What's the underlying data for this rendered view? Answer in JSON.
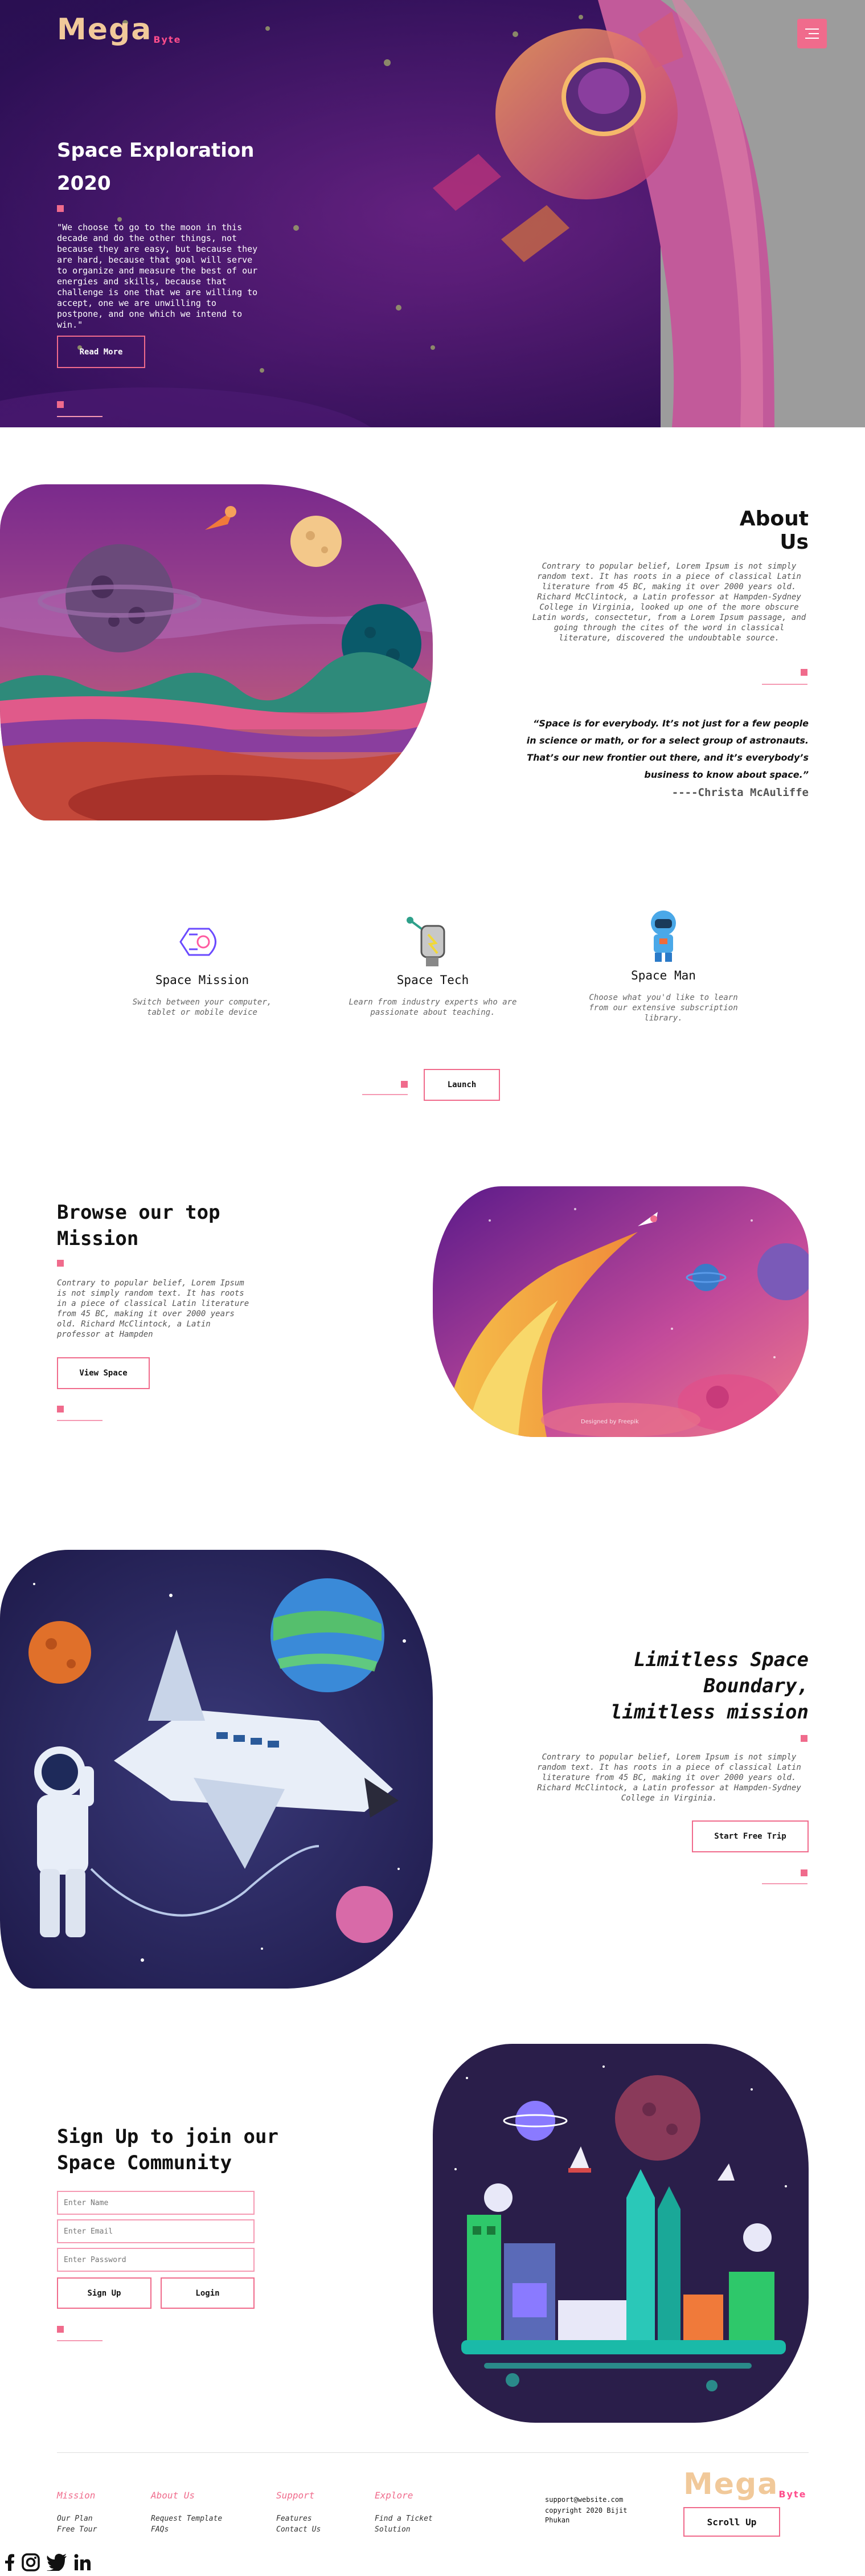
{
  "header": {
    "logo_main": "Mega",
    "logo_sub": "Byte",
    "menu_icon": "menu-icon"
  },
  "hero": {
    "title_line1": "Space Exploration",
    "title_line2": "2020",
    "quote": "\"We choose to go to the moon in this decade and do the other things, not because they are easy, but because they are hard, because that goal will serve to organize and measure the best of our energies and skills, because that challenge is one that we are willing to accept, one we are unwilling to postpone, and one which we intend to win.\"",
    "button": "Read More"
  },
  "about": {
    "title": "About Us",
    "text": "Contrary to popular belief, Lorem Ipsum is not simply random text. It has roots in a piece of classical Latin literature from 45 BC, making it over 2000 years old. Richard McClintock, a Latin professor at Hampden-Sydney College in Virginia, looked up one of the more obscure Latin words, consectetur, from a Lorem Ipsum passage, and going through the cites of the word in classical literature, discovered the undoubtable source.",
    "quote": "“Space is for everybody. It’s not just for a few people in science or math, or for a select group of astronauts. That’s our new frontier out there, and it’s everybody’s business to know about space.”",
    "quote_author": "----Christa McAuliffe"
  },
  "services": {
    "cards": [
      {
        "icon": "rocket-icon",
        "title": "Space Mission",
        "text": "Switch between your computer, tablet or mobile device"
      },
      {
        "icon": "space-tech-icon",
        "title": "Space Tech",
        "text": "Learn from industry experts who are passionate about teaching."
      },
      {
        "icon": "astronaut-icon",
        "title": "Space Man",
        "text": "Choose what you'd like to learn from our extensive subscription library."
      }
    ],
    "button": "Launch"
  },
  "browse": {
    "title_line1": "Browse our top",
    "title_line2": "Mission",
    "text": "Contrary to popular belief, Lorem Ipsum is not simply random text. It has roots in a piece of classical Latin literature from 45 BC, making it over 2000 years old. Richard McClintock, a Latin professor at Hampden",
    "button": "View Space",
    "image_credit": "Designed by Freepik"
  },
  "limitless": {
    "title_line1": "Limitless Space",
    "title_line2": "Boundary,",
    "title_line3": "limitless mission",
    "text": "Contrary to popular belief, Lorem Ipsum is not simply random text. It has roots in a piece of classical Latin literature from 45 BC, making it over 2000 years old. Richard McClintock, a Latin professor at Hampden-Sydney College in Virginia.",
    "button": "Start Free Trip"
  },
  "signup": {
    "title_line1": "Sign Up to join our",
    "title_line2": "Space Community",
    "name_placeholder": "Enter Name",
    "email_placeholder": "Enter Email",
    "password_placeholder": "Enter Password",
    "signup_button": "Sign Up",
    "login_button": "Login"
  },
  "footer": {
    "columns": [
      {
        "heading": "Mission",
        "links": [
          "Our Plan",
          "Free Tour"
        ]
      },
      {
        "heading": "About Us",
        "links": [
          "Request Template",
          "FAQs"
        ]
      },
      {
        "heading": "Support",
        "links": [
          "Features",
          "Contact Us"
        ]
      },
      {
        "heading": "Explore",
        "links": [
          "Find a Ticket",
          "Solution"
        ]
      }
    ],
    "email": "support@website.com",
    "copyright": "copyright 2020 Bijit Phukan",
    "logo_main": "Mega",
    "logo_sub": "Byte",
    "scroll_button": "Scroll Up",
    "social_icons": [
      "facebook-icon",
      "instagram-icon",
      "twitter-icon",
      "linkedin-icon"
    ]
  },
  "colors": {
    "accent": "#f06b8c",
    "accent_light": "#f59ab3",
    "hero_bg": "#3a1268",
    "logo": "#f1c99a"
  }
}
